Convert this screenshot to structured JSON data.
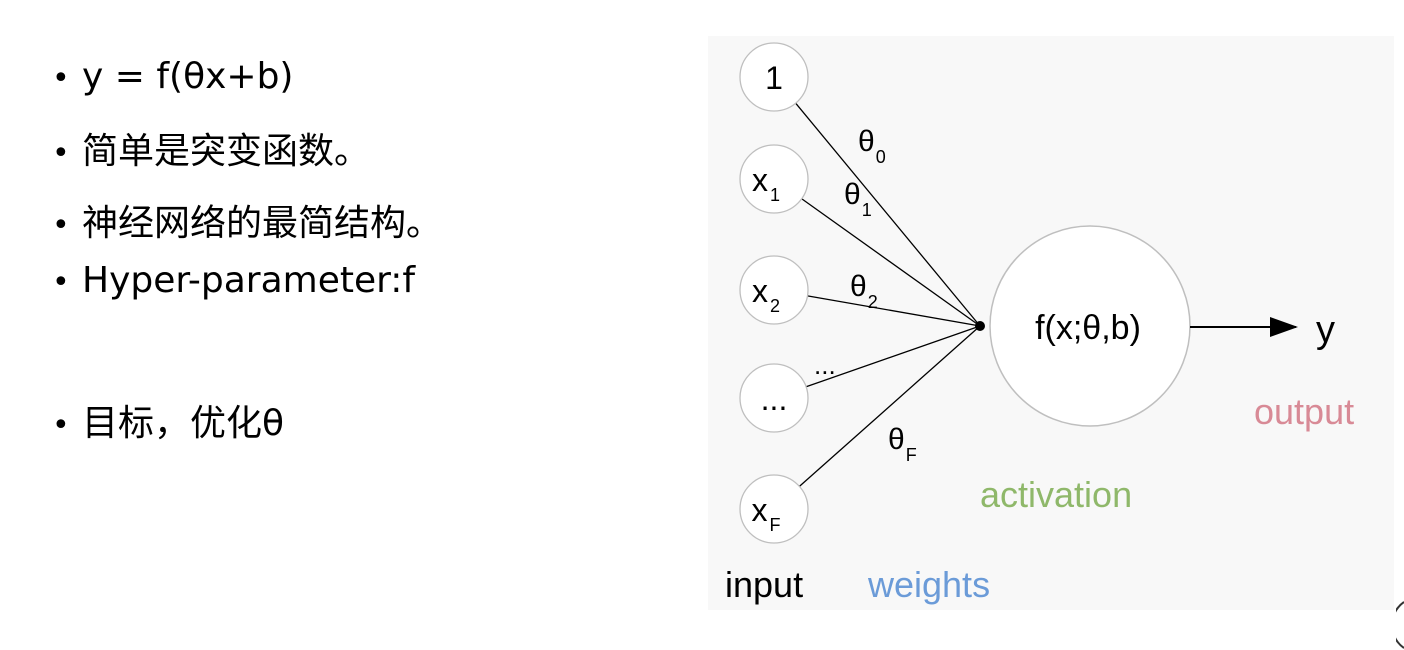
{
  "bullets": [
    "y = f(θx+b)",
    "简单是突变函数。",
    "神经网络的最简结构。",
    "Hyper-parameter:f",
    "目标，优化θ"
  ],
  "diagram": {
    "inputs": [
      {
        "main": "1",
        "sub": ""
      },
      {
        "main": "x",
        "sub": "1"
      },
      {
        "main": "x",
        "sub": "2"
      },
      {
        "main": "...",
        "sub": ""
      },
      {
        "main": "x",
        "sub": "F"
      }
    ],
    "weights": [
      {
        "main": "θ",
        "sub": "0"
      },
      {
        "main": "θ",
        "sub": "1"
      },
      {
        "main": "θ",
        "sub": "2"
      },
      {
        "main": "...",
        "sub": ""
      },
      {
        "main": "θ",
        "sub": "F"
      }
    ],
    "activation_node_label": "f(x;θ,b)",
    "output_symbol": "y",
    "legend": {
      "input": "input",
      "weights": "weights",
      "activation": "activation",
      "output": "output"
    },
    "colors": {
      "weights": "#6b9bd8",
      "activation": "#8fb86a",
      "output": "#d88a96"
    }
  }
}
